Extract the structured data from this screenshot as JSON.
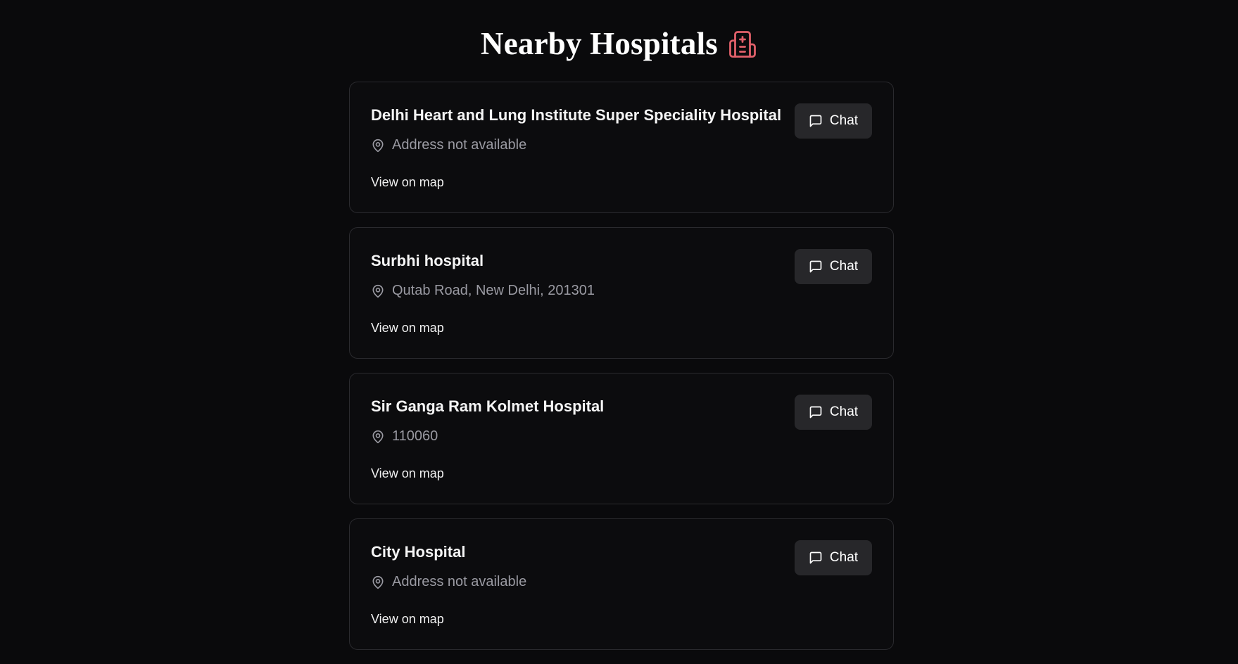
{
  "header": {
    "title": "Nearby Hospitals",
    "icon": "hospital-icon",
    "icon_color": "#e0606a"
  },
  "hospitals": [
    {
      "name": "Delhi Heart and Lung Institute Super Speciality Hospital",
      "address": "Address not available",
      "map_label": "View on map",
      "chat_label": "Chat"
    },
    {
      "name": "Surbhi hospital",
      "address": "Qutab Road, New Delhi, 201301",
      "map_label": "View on map",
      "chat_label": "Chat"
    },
    {
      "name": "Sir Ganga Ram Kolmet Hospital",
      "address": "110060",
      "map_label": "View on map",
      "chat_label": "Chat"
    },
    {
      "name": "City Hospital",
      "address": "Address not available",
      "map_label": "View on map",
      "chat_label": "Chat"
    }
  ],
  "icons": {
    "address": "map-pin-icon",
    "chat": "message-square-icon"
  },
  "colors": {
    "background": "#0a0a0c",
    "card_border": "#2a2a2e",
    "button_bg": "#27272a",
    "muted_text": "#9a9aa2"
  }
}
